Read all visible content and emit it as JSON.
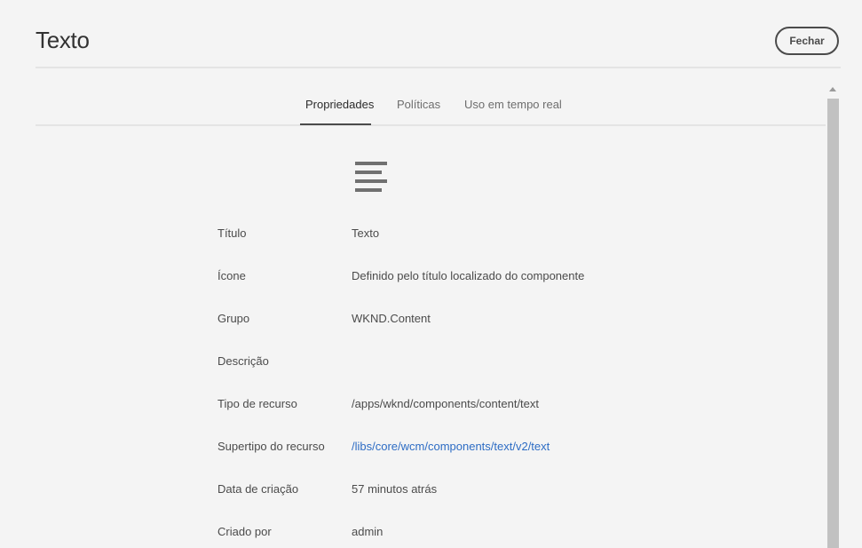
{
  "header": {
    "title": "Texto",
    "close_label": "Fechar"
  },
  "tabs": [
    {
      "label": "Propriedades",
      "active": true
    },
    {
      "label": "Políticas",
      "active": false
    },
    {
      "label": "Uso em tempo real",
      "active": false
    }
  ],
  "component_icon": "text-align-left-icon",
  "properties": [
    {
      "label": "Título",
      "value": "Texto"
    },
    {
      "label": "Ícone",
      "value": "Definido pelo título localizado do componente"
    },
    {
      "label": "Grupo",
      "value": "WKND.Content"
    },
    {
      "label": "Descrição",
      "value": ""
    },
    {
      "label": "Tipo de recurso",
      "value": "/apps/wknd/components/content/text"
    },
    {
      "label": "Supertipo do recurso",
      "value": "/libs/core/wcm/components/text/v2/text",
      "is_link": true
    },
    {
      "label": "Data de criação",
      "value": "57 minutos atrás"
    },
    {
      "label": "Criado por",
      "value": "admin"
    }
  ],
  "colors": {
    "background": "#f4f4f4",
    "text": "#4b4b4b",
    "link": "#2d6cc4",
    "divider": "#e4e4e4"
  }
}
